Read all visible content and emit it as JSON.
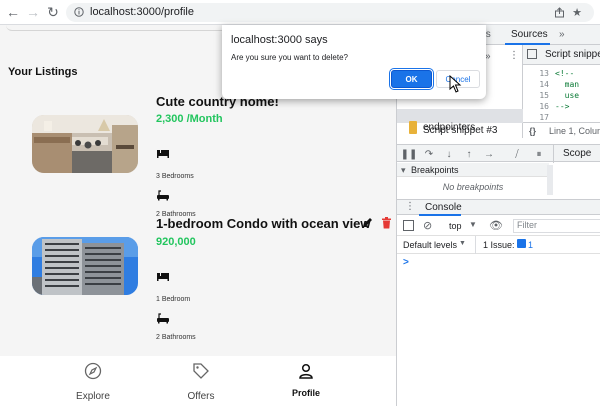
{
  "browser": {
    "url": "localhost:3000/profile"
  },
  "app": {
    "section_title": "Your Listings",
    "listings": [
      {
        "title": "Cute country home!",
        "price": "2,300 /Month",
        "bedrooms": "3 Bedrooms",
        "bathrooms": "2 Bathrooms"
      },
      {
        "title": "1-bedroom Condo with ocean view",
        "price": "920,000",
        "bedrooms": "1 Bedroom",
        "bathrooms": "2 Bathrooms"
      }
    ],
    "nav": {
      "explore": "Explore",
      "offers": "Offers",
      "profile": "Profile"
    },
    "colors": {
      "price": "#22c55e",
      "delete": "#e53935"
    }
  },
  "dialog": {
    "title": "localhost:3000 says",
    "message": "Are you sure you want to delete?",
    "ok": "OK",
    "cancel": "Cancel"
  },
  "devtools": {
    "tabs": {
      "partial": "ts",
      "sources": "Sources",
      "more": "»"
    },
    "snippet_tab": "Script snippe",
    "files": [
      "Script snippet #3",
      "endpointers"
    ],
    "code_lines": [
      {
        "num": "13",
        "text": "<!--"
      },
      {
        "num": "14",
        "text": "  man"
      },
      {
        "num": "15",
        "text": "  use"
      },
      {
        "num": "16",
        "text": "-->"
      },
      {
        "num": "17",
        "text": ""
      }
    ],
    "status": "Line 1, Colum",
    "scope": "Scope",
    "breakpoints_header": "Breakpoints",
    "breakpoints_empty": "No breakpoints",
    "console_tab": "Console",
    "context": "top",
    "filter_placeholder": "Filter",
    "levels": "Default levels",
    "issues": "1 Issue:",
    "issue_count": "1",
    "prompt": ">"
  }
}
